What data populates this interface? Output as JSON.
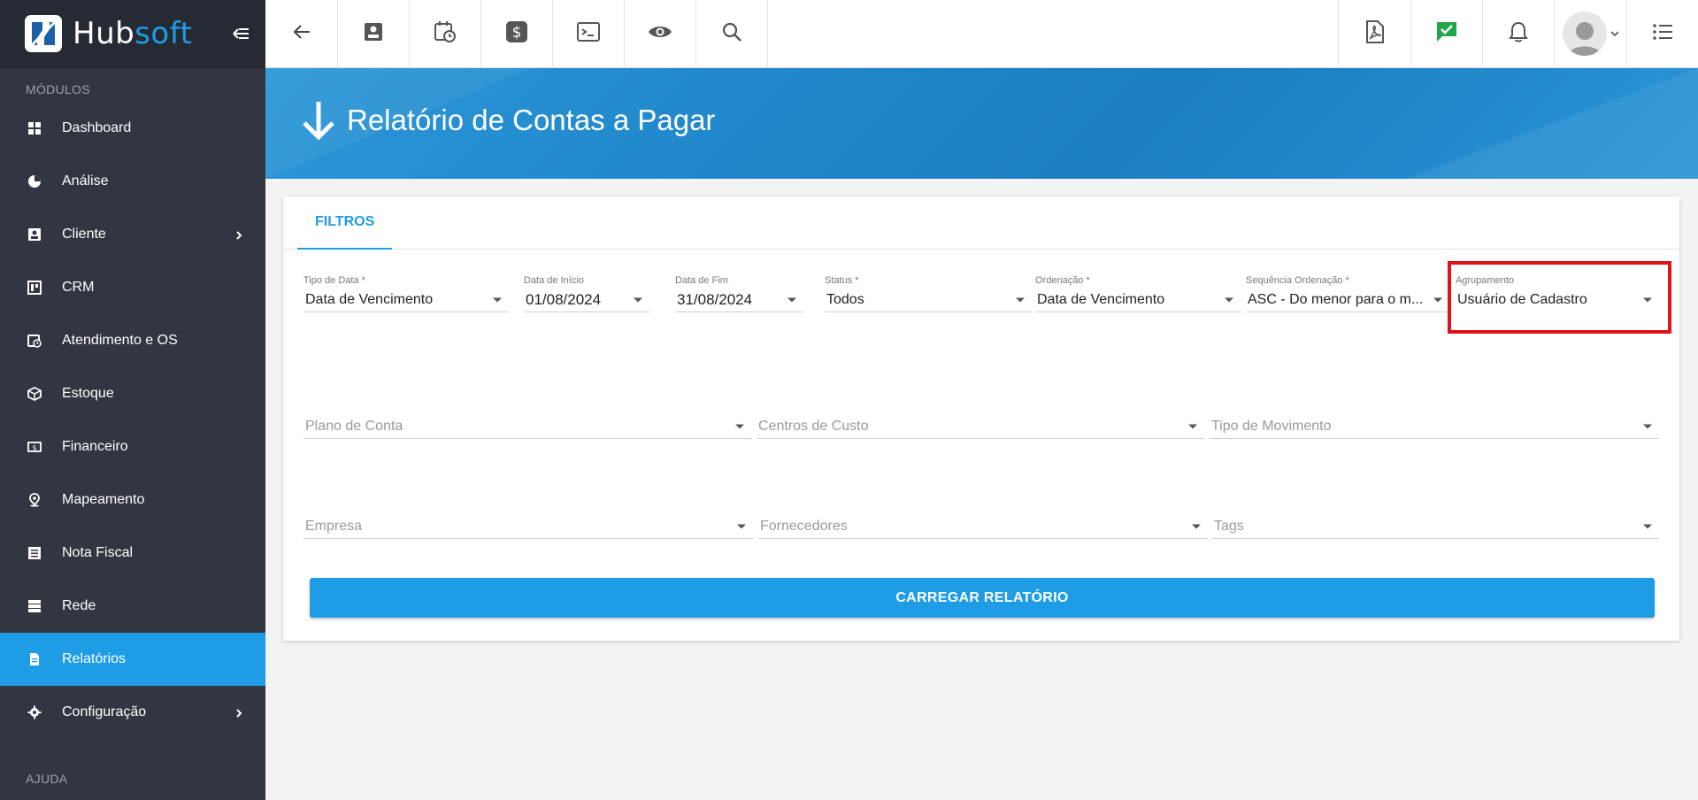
{
  "brand": {
    "name_part1": "Hub",
    "name_part2": "soft"
  },
  "sidebar": {
    "modules_label": "MÓDULOS",
    "help_label": "AJUDA",
    "items": [
      {
        "label": "Dashboard",
        "icon": "dashboard-icon"
      },
      {
        "label": "Análise",
        "icon": "pie-chart-icon"
      },
      {
        "label": "Cliente",
        "icon": "contact-card-icon",
        "has_submenu": true
      },
      {
        "label": "CRM",
        "icon": "board-icon"
      },
      {
        "label": "Atendimento e OS",
        "icon": "calendar-clock-icon"
      },
      {
        "label": "Estoque",
        "icon": "box-icon"
      },
      {
        "label": "Financeiro",
        "icon": "money-icon"
      },
      {
        "label": "Mapeamento",
        "icon": "map-pin-icon"
      },
      {
        "label": "Nota Fiscal",
        "icon": "document-list-icon"
      },
      {
        "label": "Rede",
        "icon": "server-icon"
      },
      {
        "label": "Relatórios",
        "icon": "report-icon",
        "active": true
      },
      {
        "label": "Configuração",
        "icon": "gear-icon",
        "has_submenu": true
      }
    ]
  },
  "topbar": {
    "left_icons": [
      "back-arrow-icon",
      "contact-card-icon",
      "calendar-clock-icon",
      "dollar-icon",
      "terminal-icon",
      "eye-icon",
      "search-icon"
    ],
    "right_icons": [
      "pdf-icon",
      "check-message-icon",
      "bell-icon"
    ]
  },
  "page": {
    "title": "Relatório de Contas a Pagar"
  },
  "tabs": {
    "filters": "FILTROS"
  },
  "filters": {
    "tipo_data": {
      "label": "Tipo de Data *",
      "value": "Data de Vencimento"
    },
    "data_inicio": {
      "label": "Data de Início",
      "value": "01/08/2024"
    },
    "data_fim": {
      "label": "Data de Fim",
      "value": "31/08/2024"
    },
    "status": {
      "label": "Status *",
      "value": "Todos"
    },
    "ordenacao": {
      "label": "Ordenação *",
      "value": "Data de Vencimento"
    },
    "sequencia": {
      "label": "Sequência Ordenação *",
      "value": "ASC - Do menor para o m..."
    },
    "agrupamento": {
      "label": "Agrupamento",
      "value": "Usuário de Cadastro"
    },
    "plano_conta": {
      "placeholder": "Plano de Conta"
    },
    "centros_custo": {
      "placeholder": "Centros de Custo"
    },
    "tipo_movimento": {
      "placeholder": "Tipo de Movimento"
    },
    "empresa": {
      "placeholder": "Empresa"
    },
    "fornecedores": {
      "placeholder": "Fornecedores"
    },
    "tags": {
      "placeholder": "Tags"
    }
  },
  "actions": {
    "load_report": "CARREGAR RELATÓRIO"
  },
  "colors": {
    "accent": "#1e9ce6",
    "sidebar_bg": "#323640",
    "highlight": "#e0111a"
  }
}
